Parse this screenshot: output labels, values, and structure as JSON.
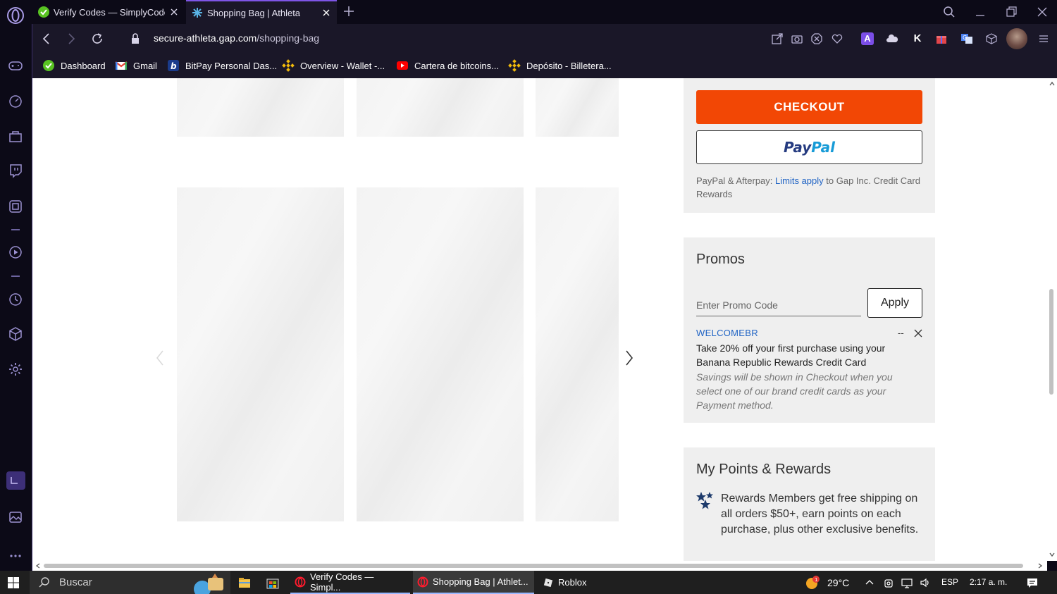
{
  "browser": {
    "tabs": [
      {
        "title": "Verify Codes — SimplyCodes",
        "active": false
      },
      {
        "title": "Shopping Bag | Athleta",
        "active": true
      }
    ],
    "url": {
      "host": "secure-athleta.gap.com",
      "path": "/shopping-bag"
    },
    "bookmarks": [
      {
        "label": "Dashboard",
        "icon": "simplycodes-icon"
      },
      {
        "label": "Gmail",
        "icon": "gmail-icon"
      },
      {
        "label": "BitPay Personal Das...",
        "icon": "bitpay-icon"
      },
      {
        "label": "Overview - Wallet -...",
        "icon": "binance-icon"
      },
      {
        "label": "Cartera de bitcoins...",
        "icon": "youtube-icon"
      },
      {
        "label": "Depósito - Billetera...",
        "icon": "binance-icon"
      }
    ]
  },
  "checkout": {
    "checkout_label": "CHECKOUT",
    "paypal_part1": "Pay",
    "paypal_part2": "Pal",
    "note_prefix": "PayPal & Afterpay: ",
    "note_link": "Limits apply",
    "note_suffix": " to Gap Inc. Credit Card Rewards"
  },
  "promos": {
    "title": "Promos",
    "input_placeholder": "Enter Promo Code",
    "apply_label": "Apply",
    "applied": {
      "code": "WELCOMEBR",
      "amount": "--",
      "description": "Take 20% off your first purchase using your Banana Republic Rewards Credit Card",
      "note": "Savings will be shown in Checkout when you select one of our brand credit cards as your Payment method."
    }
  },
  "rewards": {
    "title": "My Points & Rewards",
    "text": "Rewards Members get free shipping on all orders $50+, earn points on each purchase, plus other exclusive benefits."
  },
  "taskbar": {
    "search_label": "Buscar",
    "apps": [
      {
        "label": "Verify Codes — Simpl...",
        "state": "open"
      },
      {
        "label": "Shopping Bag | Athlet...",
        "state": "active"
      },
      {
        "label": "Roblox",
        "state": "idle"
      }
    ],
    "weather": "29°C",
    "language": "ESP",
    "time": "2:17 a. m."
  },
  "colors": {
    "checkout_orange": "#f24705",
    "link_blue": "#1f63c4",
    "opera_accent": "#7e55e6"
  }
}
